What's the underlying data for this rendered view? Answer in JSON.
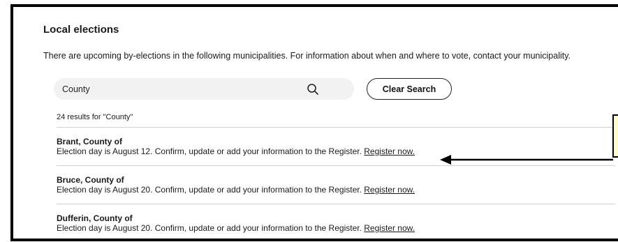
{
  "section": {
    "title": "Local elections",
    "intro": "There are upcoming by-elections in the following municipalities. For information about when and where to vote, contact your municipality."
  },
  "search": {
    "value": "County",
    "icon": "search-icon",
    "clear_label": "Clear Search"
  },
  "results": {
    "count_text": "24 results for \"County\"",
    "items": [
      {
        "name": "Brant, County of",
        "desc": "Election day is August 12. Confirm, update or add your information to the Register.",
        "link": "Register now."
      },
      {
        "name": "Bruce, County of",
        "desc": "Election day is August 20. Confirm, update or add your information to the Register.",
        "link": "Register now."
      },
      {
        "name": "Dufferin, County of",
        "desc": "Election day is August 20. Confirm, update or add your information to the Register.",
        "link": "Register now."
      }
    ]
  },
  "annotation": {
    "callout_color": "#fffcc8",
    "arrow_color": "#000000"
  }
}
